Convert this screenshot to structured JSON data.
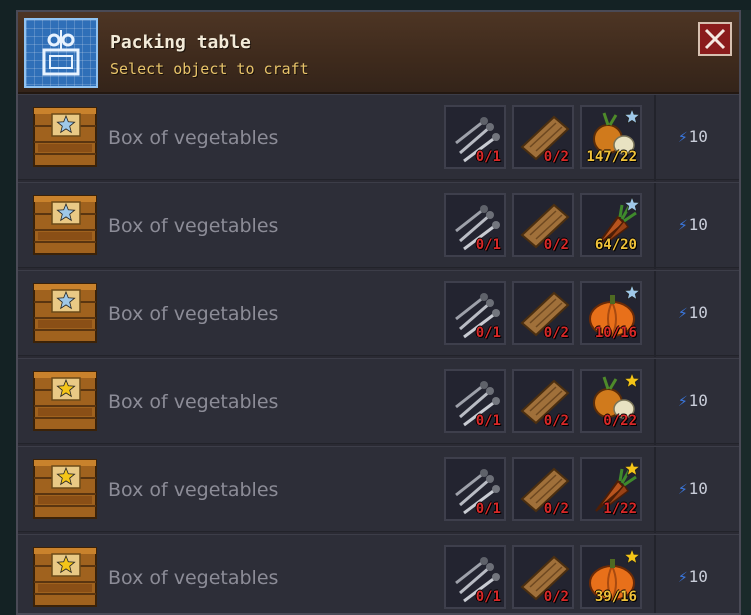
{
  "window": {
    "title": "Packing table",
    "subtitle": "Select object to craft",
    "close_label": "×"
  },
  "colors": {
    "header_bg": "#3e2a1c",
    "row_bg": "#2d2e38",
    "missing_count": "#d82828",
    "ok_count": "#f0c23a",
    "energy_bolt": "#3a78e0",
    "star_silver": "#9fc8e8",
    "star_gold": "#f5c518"
  },
  "recipes": [
    {
      "label": "Box of vegetables",
      "crate_star": "silver",
      "ingredients": [
        {
          "icon": "nails-icon",
          "count": "0/1",
          "ok": false
        },
        {
          "icon": "wood-plank-icon",
          "count": "0/2",
          "ok": false
        },
        {
          "icon": "onion-icon",
          "count": "147/22",
          "ok": true,
          "star": "silver"
        }
      ],
      "energy": "10"
    },
    {
      "label": "Box of vegetables",
      "crate_star": "silver",
      "ingredients": [
        {
          "icon": "nails-icon",
          "count": "0/1",
          "ok": false
        },
        {
          "icon": "wood-plank-icon",
          "count": "0/2",
          "ok": false
        },
        {
          "icon": "carrot-icon",
          "count": "64/20",
          "ok": true,
          "star": "silver"
        }
      ],
      "energy": "10"
    },
    {
      "label": "Box of vegetables",
      "crate_star": "silver",
      "ingredients": [
        {
          "icon": "nails-icon",
          "count": "0/1",
          "ok": false
        },
        {
          "icon": "wood-plank-icon",
          "count": "0/2",
          "ok": false
        },
        {
          "icon": "pumpkin-icon",
          "count": "10/16",
          "ok": false,
          "star": "silver"
        }
      ],
      "energy": "10"
    },
    {
      "label": "Box of vegetables",
      "crate_star": "gold",
      "ingredients": [
        {
          "icon": "nails-icon",
          "count": "0/1",
          "ok": false
        },
        {
          "icon": "wood-plank-icon",
          "count": "0/2",
          "ok": false
        },
        {
          "icon": "onion-icon",
          "count": "0/22",
          "ok": false,
          "star": "gold"
        }
      ],
      "energy": "10"
    },
    {
      "label": "Box of vegetables",
      "crate_star": "gold",
      "ingredients": [
        {
          "icon": "nails-icon",
          "count": "0/1",
          "ok": false
        },
        {
          "icon": "wood-plank-icon",
          "count": "0/2",
          "ok": false
        },
        {
          "icon": "carrot-icon",
          "count": "1/22",
          "ok": false,
          "star": "gold"
        }
      ],
      "energy": "10"
    },
    {
      "label": "Box of vegetables",
      "crate_star": "gold",
      "ingredients": [
        {
          "icon": "nails-icon",
          "count": "0/1",
          "ok": false
        },
        {
          "icon": "wood-plank-icon",
          "count": "0/2",
          "ok": false
        },
        {
          "icon": "pumpkin-icon",
          "count": "39/16",
          "ok": true,
          "star": "gold"
        }
      ],
      "energy": "10"
    }
  ]
}
